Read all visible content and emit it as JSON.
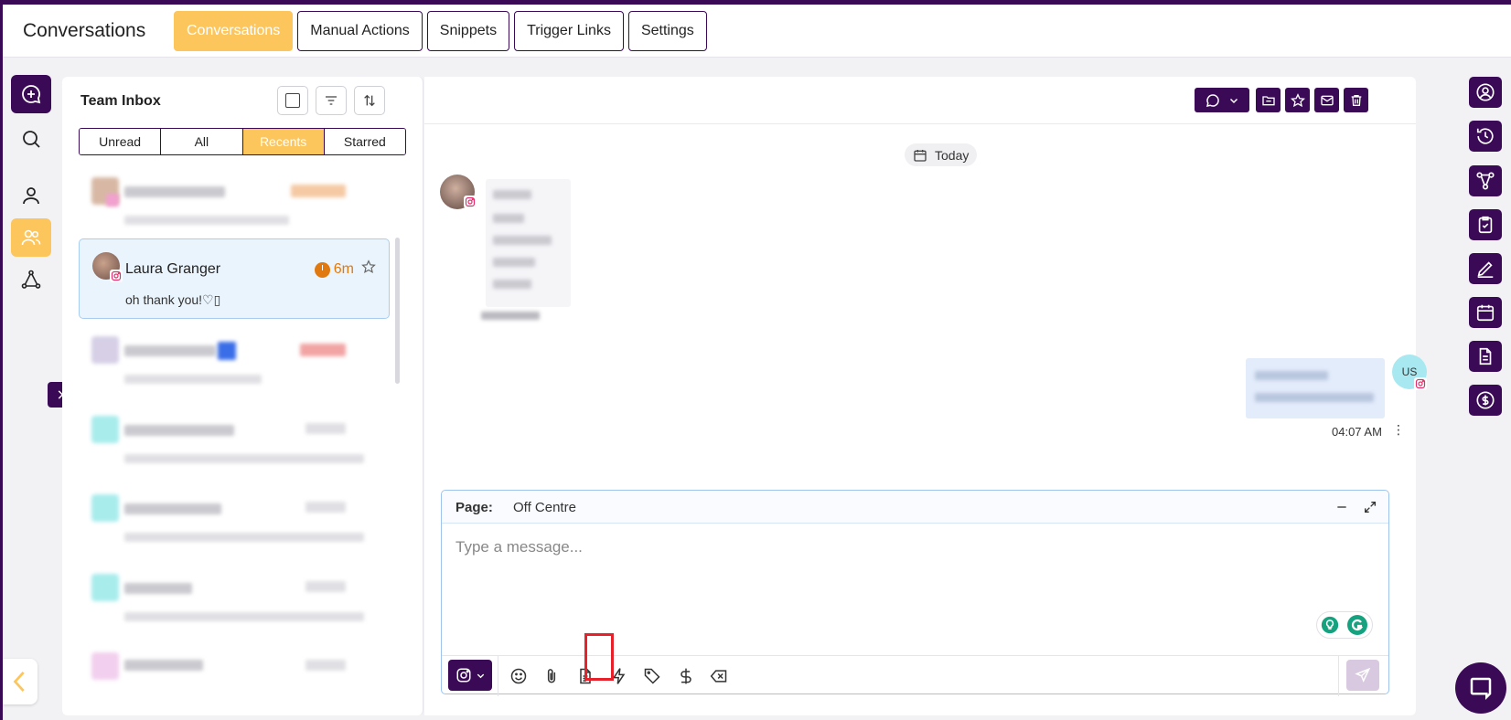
{
  "header": {
    "app_title": "Conversations",
    "tabs": [
      {
        "label": "Conversations",
        "active": true
      },
      {
        "label": "Manual Actions",
        "active": false
      },
      {
        "label": "Snippets",
        "active": false
      },
      {
        "label": "Trigger Links",
        "active": false
      },
      {
        "label": "Settings",
        "active": false
      }
    ]
  },
  "inbox": {
    "title": "Team Inbox",
    "filters": [
      "Unread",
      "All",
      "Recents",
      "Starred"
    ],
    "active_filter": "Recents",
    "selected_conversation": {
      "name": "Laura Granger",
      "time": "6m",
      "preview": "oh thank you!♡▯"
    }
  },
  "chat": {
    "date_divider": "Today",
    "outgoing_avatar": "US",
    "outgoing_time": "04:07 AM",
    "kebab": "⋮",
    "composer": {
      "page_label": "Page:",
      "page_value": "Off Centre",
      "placeholder": "Type a message..."
    }
  },
  "colors": {
    "brand": "#3b0a57",
    "accent": "#fcc65c",
    "timer": "#e07a10",
    "instagram": "#e1306c",
    "highlight": "#e8202a"
  }
}
